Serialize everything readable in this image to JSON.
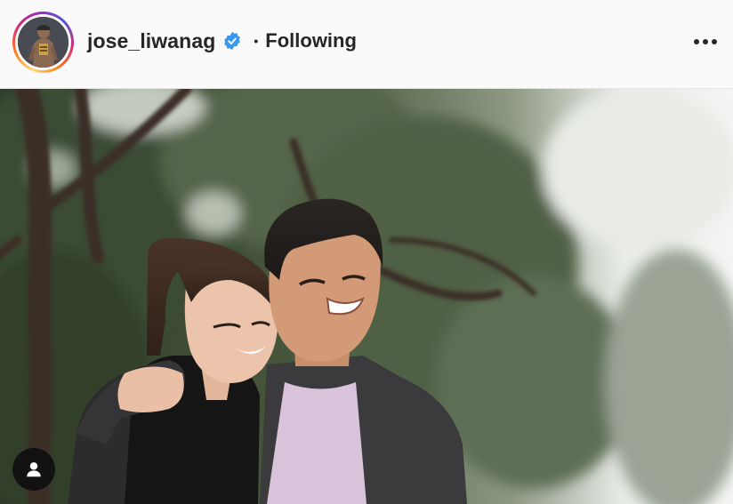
{
  "post": {
    "username": "jose_liwanag",
    "separator": "•",
    "follow_status": "Following",
    "verified": true,
    "photo_alt": "Post photo"
  },
  "icons": {
    "verified": "verified-badge-icon",
    "more": "more-options-icon",
    "tagged_users": "tagged-user-icon"
  },
  "colors": {
    "verified_blue": "#3897f0",
    "text": "#262626",
    "header_bg": "#fafafa"
  }
}
